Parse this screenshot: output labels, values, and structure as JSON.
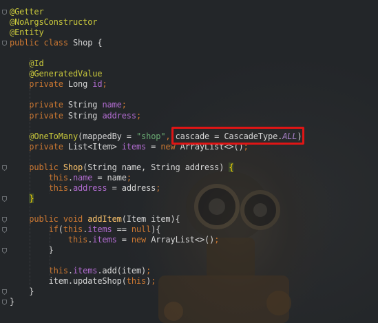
{
  "editor": {
    "language": "java",
    "lines": [
      [
        {
          "t": "@Getter",
          "c": "ann"
        }
      ],
      [
        {
          "t": "@NoArgsConstructor",
          "c": "ann"
        }
      ],
      [
        {
          "t": "@Entity",
          "c": "ann"
        }
      ],
      [
        {
          "t": "public class ",
          "c": "kw"
        },
        {
          "t": "Shop {",
          "c": "df"
        }
      ],
      [],
      [
        {
          "t": "    @Id",
          "c": "ann"
        }
      ],
      [
        {
          "t": "    @GeneratedValue",
          "c": "ann"
        }
      ],
      [
        {
          "t": "    private ",
          "c": "kw"
        },
        {
          "t": "Long ",
          "c": "df"
        },
        {
          "t": "id",
          "c": "fld"
        },
        {
          "t": ";",
          "c": "kw"
        }
      ],
      [],
      [
        {
          "t": "    private ",
          "c": "kw"
        },
        {
          "t": "String ",
          "c": "df"
        },
        {
          "t": "name",
          "c": "fld"
        },
        {
          "t": ";",
          "c": "kw"
        }
      ],
      [
        {
          "t": "    private ",
          "c": "kw"
        },
        {
          "t": "String ",
          "c": "df"
        },
        {
          "t": "address",
          "c": "fld"
        },
        {
          "t": ";",
          "c": "kw"
        }
      ],
      [],
      [
        {
          "t": "    @OneToMany",
          "c": "ann"
        },
        {
          "t": "(",
          "c": "df"
        },
        {
          "t": "mappedBy",
          "c": "df"
        },
        {
          "t": " = ",
          "c": "df"
        },
        {
          "t": "\"shop\"",
          "c": "str"
        },
        {
          "t": ", ",
          "c": "kw"
        },
        {
          "t": "cascade",
          "c": "df"
        },
        {
          "t": " = CascadeType.",
          "c": "df"
        },
        {
          "t": "ALL",
          "c": "it"
        },
        {
          "t": ")",
          "c": "df"
        }
      ],
      [
        {
          "t": "    private ",
          "c": "kw"
        },
        {
          "t": "List<Item> ",
          "c": "df"
        },
        {
          "t": "items",
          "c": "fld"
        },
        {
          "t": " = ",
          "c": "df"
        },
        {
          "t": "new ",
          "c": "kw"
        },
        {
          "t": "ArrayList<>()",
          "c": "df"
        },
        {
          "t": ";",
          "c": "kw"
        }
      ],
      [],
      [
        {
          "t": "    public ",
          "c": "kw"
        },
        {
          "t": "Shop",
          "c": "fn"
        },
        {
          "t": "(String name, String address) ",
          "c": "df"
        },
        {
          "t": "{",
          "c": "brace"
        }
      ],
      [
        {
          "t": "        this",
          "c": "kw"
        },
        {
          "t": ".",
          "c": "df"
        },
        {
          "t": "name",
          "c": "fld"
        },
        {
          "t": " = name",
          "c": "df"
        },
        {
          "t": ";",
          "c": "kw"
        }
      ],
      [
        {
          "t": "        this",
          "c": "kw"
        },
        {
          "t": ".",
          "c": "df"
        },
        {
          "t": "address",
          "c": "fld"
        },
        {
          "t": " = address",
          "c": "df"
        },
        {
          "t": ";",
          "c": "kw"
        }
      ],
      [
        {
          "t": "    ",
          "c": "df"
        },
        {
          "t": "}",
          "c": "brace"
        }
      ],
      [],
      [
        {
          "t": "    public void ",
          "c": "kw"
        },
        {
          "t": "addItem",
          "c": "fn"
        },
        {
          "t": "(Item item){",
          "c": "df"
        }
      ],
      [
        {
          "t": "        if",
          "c": "kw"
        },
        {
          "t": "(",
          "c": "df"
        },
        {
          "t": "this",
          "c": "kw"
        },
        {
          "t": ".",
          "c": "df"
        },
        {
          "t": "items",
          "c": "fld"
        },
        {
          "t": " == ",
          "c": "df"
        },
        {
          "t": "null",
          "c": "kw"
        },
        {
          "t": "){",
          "c": "df"
        }
      ],
      [
        {
          "t": "            this",
          "c": "kw"
        },
        {
          "t": ".",
          "c": "df"
        },
        {
          "t": "items",
          "c": "fld"
        },
        {
          "t": " = ",
          "c": "df"
        },
        {
          "t": "new ",
          "c": "kw"
        },
        {
          "t": "ArrayList<>()",
          "c": "df"
        },
        {
          "t": ";",
          "c": "kw"
        }
      ],
      [
        {
          "t": "        }",
          "c": "df"
        }
      ],
      [],
      [
        {
          "t": "        this",
          "c": "kw"
        },
        {
          "t": ".",
          "c": "df"
        },
        {
          "t": "items",
          "c": "fld"
        },
        {
          "t": ".add(item)",
          "c": "df"
        },
        {
          "t": ";",
          "c": "kw"
        }
      ],
      [
        {
          "t": "        item.updateShop(",
          "c": "df"
        },
        {
          "t": "this",
          "c": "kw"
        },
        {
          "t": ")",
          "c": "df"
        },
        {
          "t": ";",
          "c": "kw"
        }
      ],
      [
        {
          "t": "    }",
          "c": "df"
        }
      ],
      [
        {
          "t": "}",
          "c": "df"
        }
      ]
    ],
    "fold_markers": [
      0,
      3,
      15,
      18,
      20,
      21,
      23,
      27,
      28
    ],
    "colors": {
      "background": "#232629",
      "annotation": "#c9c83c",
      "keyword": "#cc7832",
      "field": "#b26cd1",
      "string": "#6aab73",
      "method": "#ffc66d",
      "constant": "#a981c9",
      "highlight_box": "#e01515"
    }
  }
}
